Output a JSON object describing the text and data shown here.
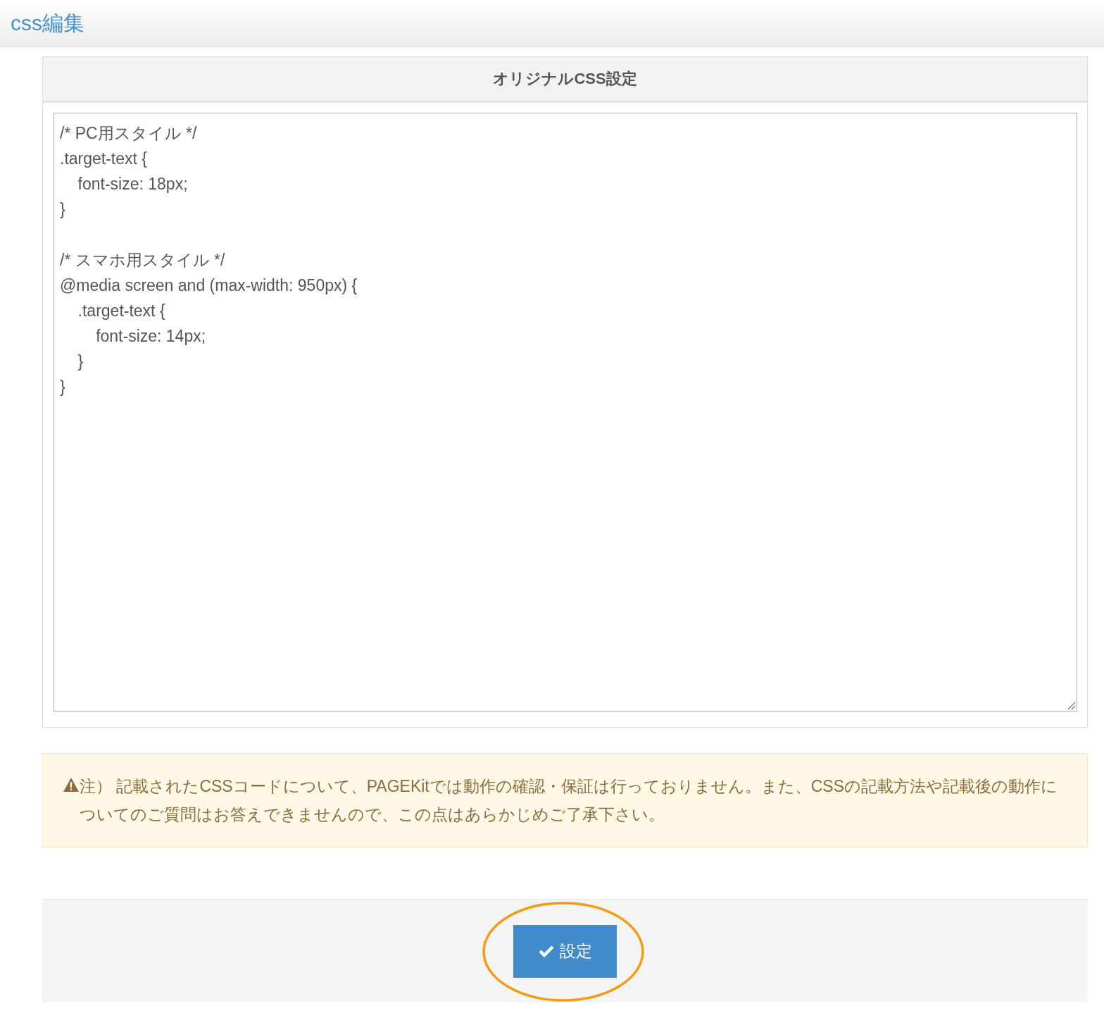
{
  "header": {
    "title": "css編集"
  },
  "panel": {
    "title": "オリジナルCSS設定",
    "code": "/* PC用スタイル */\n.target-text {\n    font-size: 18px;\n}\n\n/* スマホ用スタイル */\n@media screen and (max-width: 950px) {\n    .target-text {\n        font-size: 14px;\n    }\n}"
  },
  "notice": {
    "text": "注） 記載されたCSSコードについて、PAGEKitでは動作の確認・保証は行っておりません。また、CSSの記載方法や記載後の動作についてのご質問はお答えできませんので、この点はあらかじめご了承下さい。"
  },
  "footer": {
    "button": "設定"
  }
}
